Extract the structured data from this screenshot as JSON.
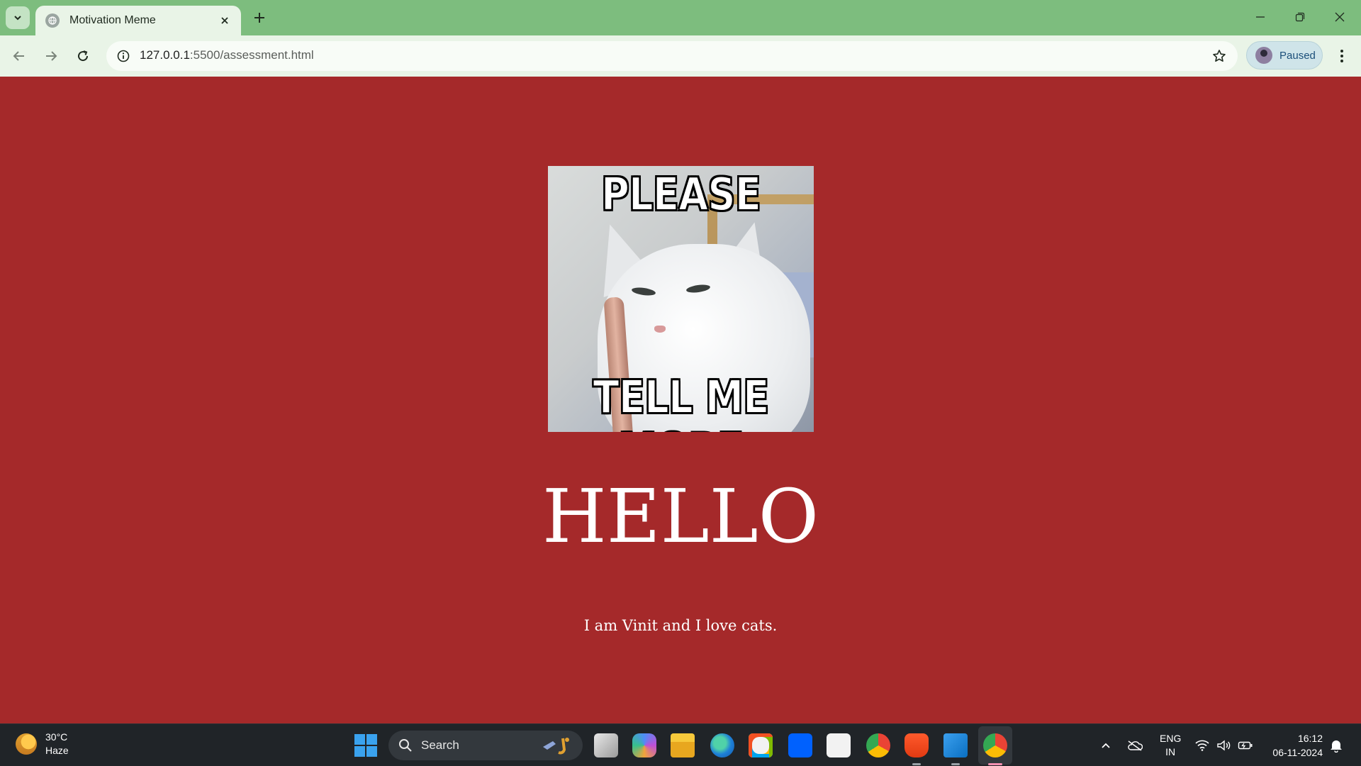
{
  "browser": {
    "tab_title": "Motivation Meme",
    "url_host": "127.0.0.1",
    "url_path": ":5500/assessment.html",
    "profile_label": "Paused"
  },
  "page": {
    "meme_top_text": "PLEASE",
    "meme_bottom_text": "TELL ME MORE",
    "heading": "HELLO",
    "tagline": "I am Vinit and I love cats.",
    "background_color": "#a5292a"
  },
  "taskbar": {
    "weather_temp": "30°C",
    "weather_desc": "Haze",
    "search_label": "Search",
    "lang_top": "ENG",
    "lang_bottom": "IN",
    "time": "16:12",
    "date": "06-11-2024",
    "apps": [
      "task-view",
      "copilot",
      "file-explorer",
      "edge",
      "microsoft-store",
      "dropbox",
      "amazon",
      "chrome",
      "brave",
      "vscode",
      "chrome-active"
    ]
  }
}
